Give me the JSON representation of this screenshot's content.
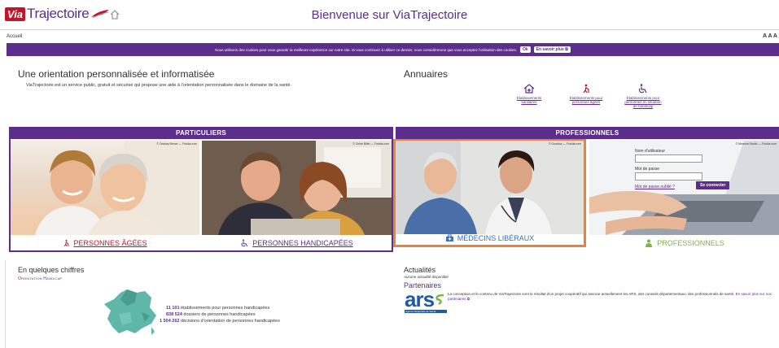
{
  "header": {
    "logo_via": "Via",
    "logo_rest": "Trajectoire",
    "title": "Bienvenue sur ViaTrajectoire"
  },
  "breadcrumb": {
    "label": "Accueil"
  },
  "font_size_controls": "A A A",
  "cookie_banner": {
    "text": "Nous utilisons des cookies pour vous garantir la meilleure expérience sur notre site. Si vous continuez à utiliser ce dernier, nous considérerons que vous acceptez l'utilisation des cookies.",
    "ok_label": "Ok",
    "more_label": "En savoir plus"
  },
  "intro": {
    "title": "Une orientation personnalisée et informatisée",
    "text": "ViaTrajectoire est un service public, gratuit et sécurisé qui propose une aide à l'orientation personnalisée dans le domaine de la santé."
  },
  "annuaires": {
    "title": "Annuaires",
    "items": [
      {
        "line1": "Établissements",
        "line2": "sanitaires",
        "line3": "",
        "icon": "hospital-icon"
      },
      {
        "line1": "Établissements pour",
        "line2": "personnes âgées",
        "line3": "",
        "icon": "elderly-icon"
      },
      {
        "line1": "Établissements pour",
        "line2": "personnes en situation",
        "line3": "de handicap",
        "icon": "wheelchair-icon"
      }
    ]
  },
  "particuliers": {
    "header": "PARTICULIERS",
    "cards": [
      {
        "credit": "© Ocskay Bence — Fotolia.com",
        "label": "PERSONNES ÂGÉES"
      },
      {
        "credit": "© Chloé Billet — Fotolia.com",
        "label": "PERSONNES HANDICAPÉES"
      }
    ]
  },
  "professionnels": {
    "header": "PROFESSIONNELS",
    "cards": [
      {
        "credit": "© Goodluz — Fotolia.com",
        "label": "MÉDECINS LIBÉRAUX"
      },
      {
        "credit": "© Minerva Studio — Fotolia.com",
        "label": "PROFESSIONNELS"
      }
    ]
  },
  "login": {
    "username_label": "Nom d'utilisateur",
    "password_label": "Mot de passe",
    "forgot_label": "Mot de passe oublié ?",
    "submit_label": "Se connecter"
  },
  "figures": {
    "title": "En quelques chiffres",
    "subtitle": "Orientation Handicap",
    "stats": [
      {
        "value": "11 101",
        "label": "établissements pour personnes handicapées"
      },
      {
        "value": "838 524",
        "label": "dossiers de personnes handicapées"
      },
      {
        "value": "1 504 262",
        "label": "décisions d'orientation de personnes handicapées"
      }
    ]
  },
  "news": {
    "title": "Actualités",
    "empty": "Aucune actualité disponible"
  },
  "partners": {
    "title": "Partenaires",
    "text": "La conception et le contenu de ViaTrajectoire sont le résultat d'un projet coopératif qui associe actuellement les ARS, des conseils départementaux, des professionnels de santé.",
    "link": "En savoir plus sur nos partenaires",
    "logo_text": "ars",
    "logo_sub": "Agence Régionale de Santé"
  },
  "colors": {
    "brand_purple": "#5b2e8c",
    "brand_red": "#c0162c",
    "highlight_orange": "#e8833a",
    "professionnels_green": "#7ab648"
  }
}
